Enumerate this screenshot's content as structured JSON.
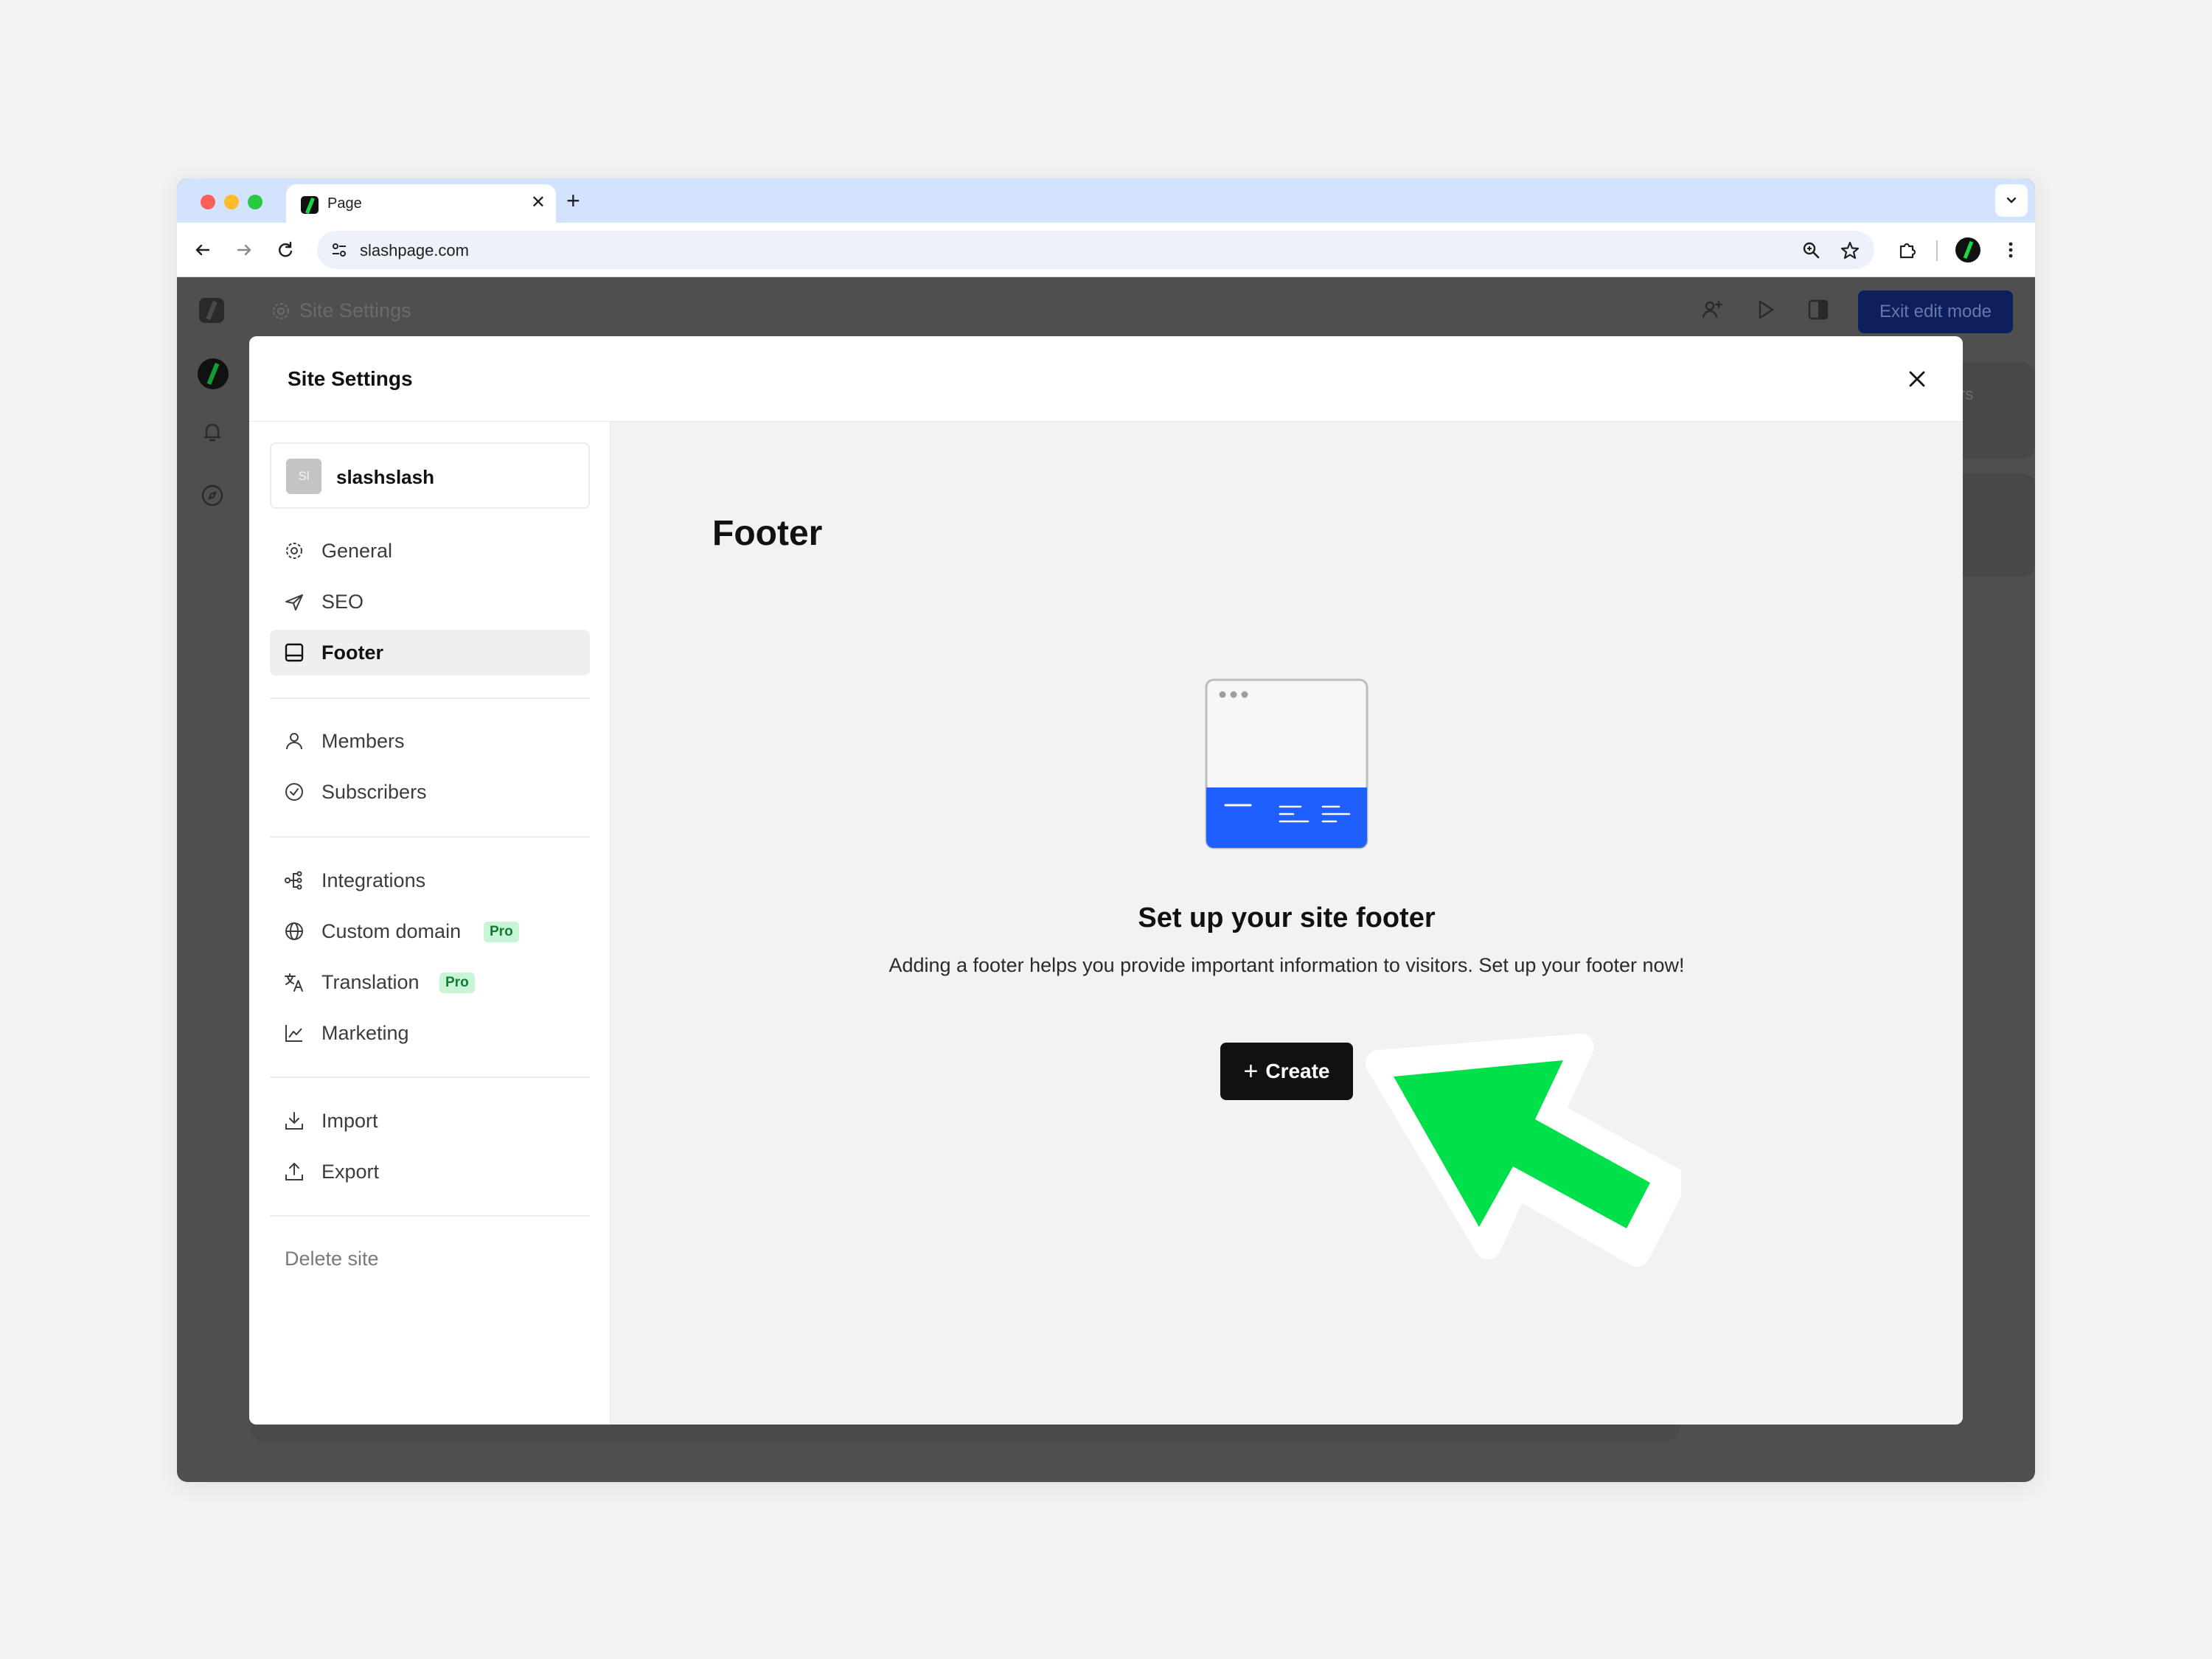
{
  "browser": {
    "tab_title": "Page",
    "tab_close": "✕",
    "new_tab": "+",
    "url": "slashpage.com"
  },
  "app": {
    "title": "Site Settings",
    "exit_button": "Exit edit mode",
    "card_text": "rs"
  },
  "modal": {
    "title": "Site Settings",
    "site": {
      "avatar_initials": "Sl",
      "name": "slashslash"
    },
    "nav_groups": [
      [
        {
          "label": "General",
          "icon": "gear-icon"
        },
        {
          "label": "SEO",
          "icon": "send-icon"
        },
        {
          "label": "Footer",
          "icon": "footer-icon",
          "active": true
        }
      ],
      [
        {
          "label": "Members",
          "icon": "user-icon"
        },
        {
          "label": "Subscribers",
          "icon": "check-circle-icon"
        }
      ],
      [
        {
          "label": "Integrations",
          "icon": "integrations-icon"
        },
        {
          "label": "Custom domain",
          "icon": "globe-icon",
          "badge": "Pro"
        },
        {
          "label": "Translation",
          "icon": "translate-icon",
          "badge": "Pro"
        },
        {
          "label": "Marketing",
          "icon": "chart-icon"
        }
      ],
      [
        {
          "label": "Import",
          "icon": "import-icon"
        },
        {
          "label": "Export",
          "icon": "export-icon"
        }
      ]
    ],
    "delete_label": "Delete site",
    "content": {
      "title": "Footer",
      "empty_title": "Set up your site footer",
      "empty_description": "Adding a footer helps you provide important information to visitors. Set up your footer now!",
      "create_label": "Create",
      "create_icon": "+"
    }
  },
  "colors": {
    "accent_blue": "#1f5eff",
    "pro_badge_bg": "#c6f6d5",
    "pro_badge_text": "#157a35",
    "annotation_arrow": "#00e04b",
    "create_button": "#111111"
  }
}
